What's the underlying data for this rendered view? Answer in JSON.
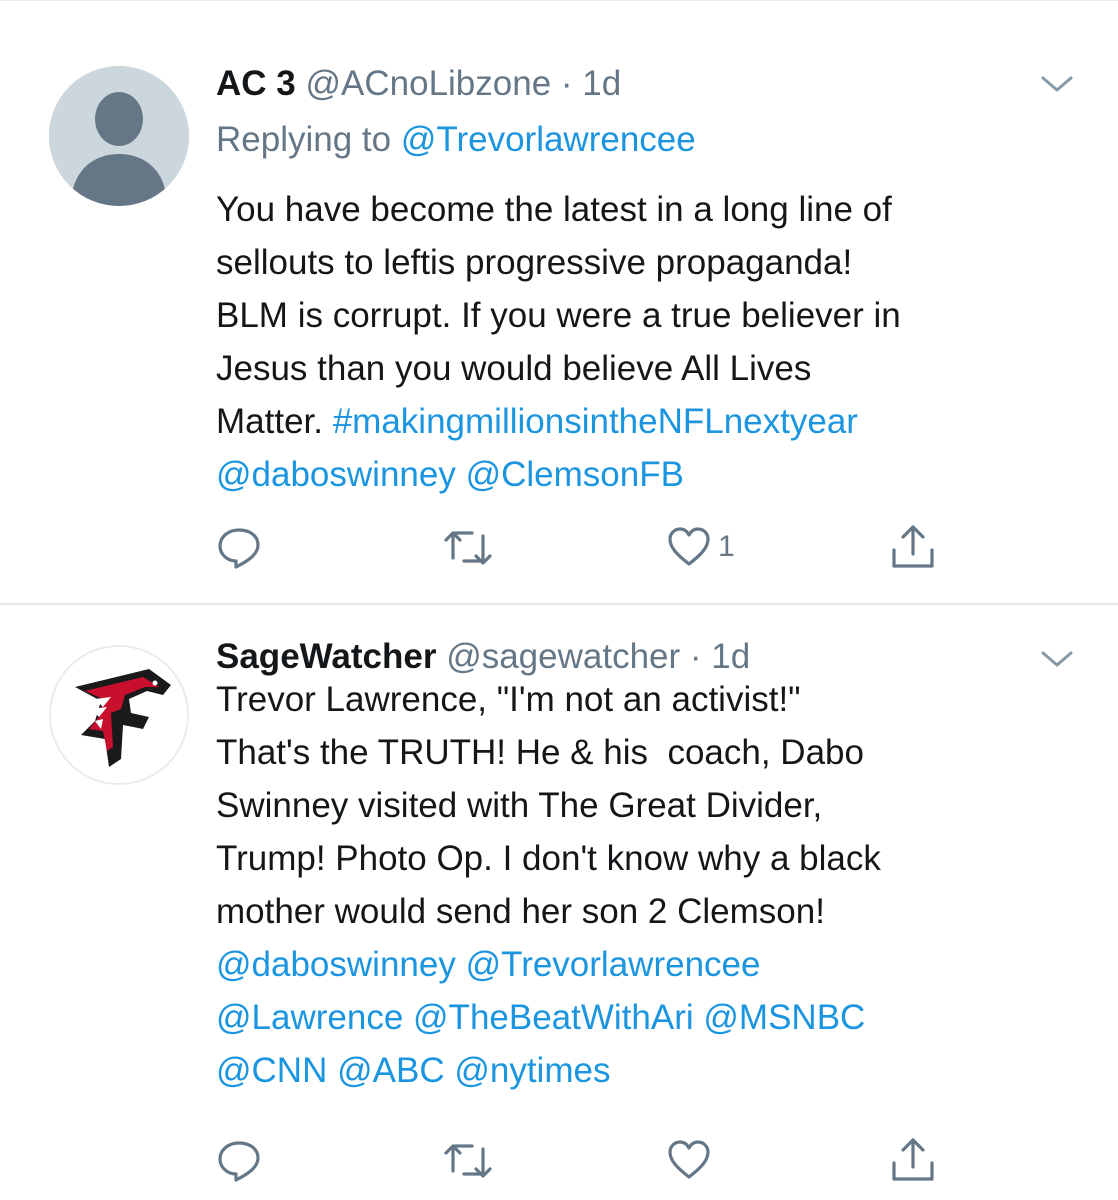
{
  "tweets": [
    {
      "name": "AC 3",
      "handle": "@ACnoLibzone",
      "separator": "·",
      "time": "1d",
      "replying_label": "Replying to",
      "replying_handle": "@Trevorlawrencee",
      "text_lines": [
        [
          {
            "t": "You have become the latest in a long line of",
            "link": false
          }
        ],
        [
          {
            "t": "sellouts to leftis progressive propaganda!",
            "link": false
          }
        ],
        [
          {
            "t": "BLM is corrupt. If you were a true believer in",
            "link": false
          }
        ],
        [
          {
            "t": "Jesus than you would believe All Lives",
            "link": false
          }
        ],
        [
          {
            "t": "Matter. ",
            "link": false
          },
          {
            "t": "#makingmillionsintheNFLnextyear",
            "link": true
          }
        ],
        [
          {
            "t": "@daboswinney",
            "link": true
          },
          {
            "t": " ",
            "link": false
          },
          {
            "t": "@ClemsonFB",
            "link": true
          }
        ]
      ],
      "like_count": "1",
      "avatar_icon": "default-profile-icon"
    },
    {
      "name": "SageWatcher",
      "handle": "@sagewatcher",
      "separator": "·",
      "time": "1d",
      "text_lines": [
        [
          {
            "t": "Trevor Lawrence, \"I'm not an activist!\"",
            "link": false
          }
        ],
        [
          {
            "t": "That's the TRUTH! He & his  coach, Dabo",
            "link": false
          }
        ],
        [
          {
            "t": "Swinney visited with The Great Divider,",
            "link": false
          }
        ],
        [
          {
            "t": "Trump! Photo Op. I don't know why a black",
            "link": false
          }
        ],
        [
          {
            "t": "mother would send her son 2 Clemson!",
            "link": false
          }
        ],
        [
          {
            "t": "@daboswinney",
            "link": true
          },
          {
            "t": " ",
            "link": false
          },
          {
            "t": "@Trevorlawrencee",
            "link": true
          }
        ],
        [
          {
            "t": "@Lawrence",
            "link": true
          },
          {
            "t": " ",
            "link": false
          },
          {
            "t": "@TheBeatWithAri",
            "link": true
          },
          {
            "t": " ",
            "link": false
          },
          {
            "t": "@MSNBC",
            "link": true
          }
        ],
        [
          {
            "t": "@CNN",
            "link": true
          },
          {
            "t": " ",
            "link": false
          },
          {
            "t": "@ABC",
            "link": true
          },
          {
            "t": " ",
            "link": false
          },
          {
            "t": "@nytimes",
            "link": true
          }
        ]
      ],
      "like_count": "",
      "avatar_icon": "falcons-logo-icon"
    }
  ],
  "icons": {
    "reply": "reply-icon",
    "retweet": "retweet-icon",
    "like": "heart-icon",
    "share": "share-icon",
    "menu": "chevron-down-icon"
  },
  "colors": {
    "text": "#14171a",
    "secondary": "#657786",
    "link": "#1b95e0",
    "divider": "#e1e8ed"
  }
}
